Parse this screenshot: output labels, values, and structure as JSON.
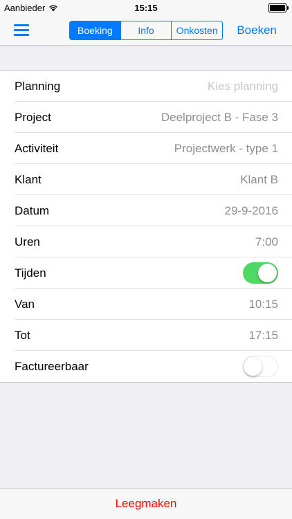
{
  "status_bar": {
    "carrier": "Aanbieder",
    "time": "15:15"
  },
  "nav": {
    "segments": [
      {
        "label": "Boeking",
        "active": true
      },
      {
        "label": "Info",
        "active": false
      },
      {
        "label": "Onkosten",
        "active": false
      }
    ],
    "action_label": "Boeken"
  },
  "form": {
    "rows": [
      {
        "label": "Planning",
        "value": "Kies planning",
        "placeholder": true
      },
      {
        "label": "Project",
        "value": "Deelproject B - Fase 3"
      },
      {
        "label": "Activiteit",
        "value": "Projectwerk - type 1"
      },
      {
        "label": "Klant",
        "value": "Klant B"
      },
      {
        "label": "Datum",
        "value": "29-9-2016"
      },
      {
        "label": "Uren",
        "value": "7:00"
      },
      {
        "label": "Tijden",
        "toggle": true,
        "on": true
      },
      {
        "label": "Van",
        "value": "10:15"
      },
      {
        "label": "Tot",
        "value": "17:15"
      },
      {
        "label": "Factureerbaar",
        "toggle": true,
        "on": false
      }
    ]
  },
  "footer": {
    "clear_label": "Leegmaken"
  },
  "colors": {
    "accent": "#007aff",
    "toggle_on": "#4cd964",
    "destructive": "#ff0000"
  }
}
